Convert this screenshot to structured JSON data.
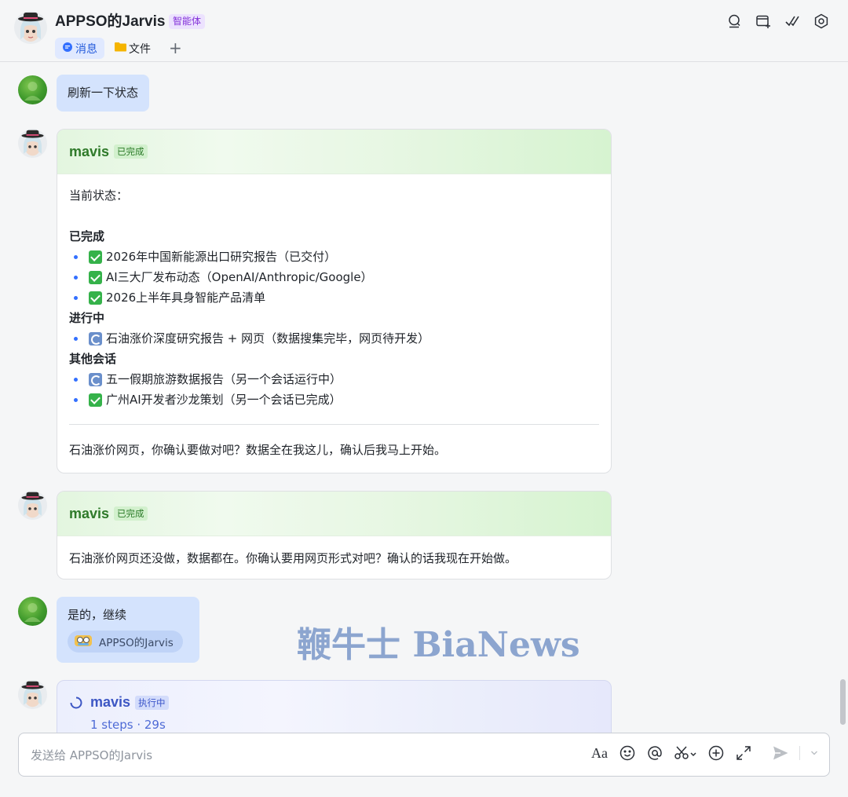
{
  "header": {
    "title": "APPSO的Jarvis",
    "badge": "智能体",
    "tabs": [
      {
        "label": "消息",
        "icon": "chat-bubble-icon",
        "active": true
      },
      {
        "label": "文件",
        "icon": "folder-icon",
        "active": false
      }
    ],
    "add_tab": "+",
    "icons": [
      "search-person-icon",
      "add-tab-icon",
      "check-task-icon",
      "settings-icon"
    ]
  },
  "messages": {
    "m1": {
      "text": "刷新一下状态"
    },
    "m2": {
      "sender": "mavis",
      "status": "已完成",
      "intro": "当前状态：",
      "sections": [
        {
          "heading": "已完成",
          "items": [
            {
              "icon": "checkmark-icon",
              "text": "2026年中国新能源出口研究报告（已交付）"
            },
            {
              "icon": "checkmark-icon",
              "text": "AI三大厂发布动态（OpenAI/Anthropic/Google）"
            },
            {
              "icon": "checkmark-icon",
              "text": "2026上半年具身智能产品清单"
            }
          ]
        },
        {
          "heading": "进行中",
          "items": [
            {
              "icon": "refresh-icon",
              "text": "石油涨价深度研究报告 + 网页（数据搜集完毕，网页待开发）"
            }
          ]
        },
        {
          "heading": "其他会话",
          "items": [
            {
              "icon": "refresh-icon",
              "text": "五一假期旅游数据报告（另一个会话运行中）"
            },
            {
              "icon": "checkmark-icon",
              "text": "广州AI开发者沙龙策划（另一个会话已完成）"
            }
          ]
        }
      ],
      "footer": "石油涨价网页，你确认要做对吧？数据全在我这儿，确认后我马上开始。"
    },
    "m3": {
      "sender": "mavis",
      "status": "已完成",
      "text": "石油涨价网页还没做，数据都在。你确认要用网页形式对吧？确认的话我现在开始做。"
    },
    "m4": {
      "text": "是的，继续",
      "reference": "APPSO的Jarvis"
    },
    "m5": {
      "sender": "mavis",
      "status": "执行中",
      "steps": "1 steps · 29s"
    }
  },
  "watermark": "鞭牛士 BiaNews",
  "input": {
    "placeholder": "发送给 APPSO的Jarvis",
    "tools": [
      "font-format-icon",
      "emoji-icon",
      "mention-icon",
      "screenshot-icon",
      "plus-circle-icon",
      "expand-icon",
      "send-icon",
      "chevron-down-icon"
    ],
    "format_label": "Aa"
  }
}
